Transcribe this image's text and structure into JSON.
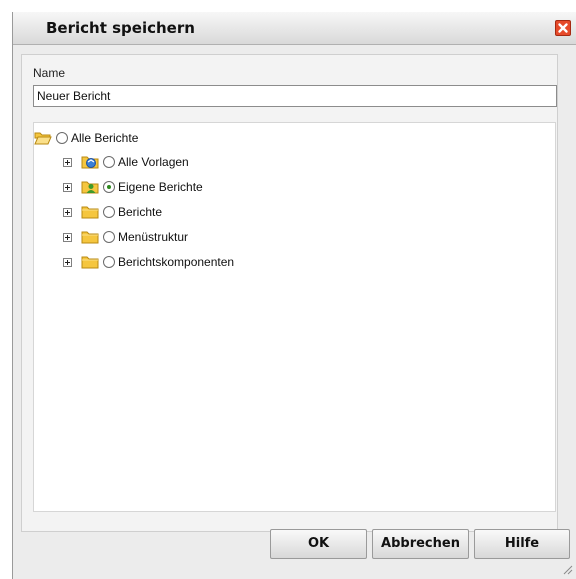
{
  "dialog": {
    "title": "Bericht speichern",
    "name_label": "Name",
    "name_value": "Neuer Bericht"
  },
  "tree": {
    "root": {
      "label": "Alle Berichte",
      "icon": "folder-open-icon",
      "selected": false
    },
    "children": [
      {
        "label": "Alle Vorlagen",
        "icon": "templates-folder-icon",
        "selected": false
      },
      {
        "label": "Eigene Berichte",
        "icon": "user-folder-icon",
        "selected": true
      },
      {
        "label": "Berichte",
        "icon": "folder-icon",
        "selected": false
      },
      {
        "label": "Menüstruktur",
        "icon": "folder-icon",
        "selected": false
      },
      {
        "label": "Berichtskomponenten",
        "icon": "folder-icon",
        "selected": false
      }
    ]
  },
  "buttons": {
    "ok": "OK",
    "cancel": "Abbrechen",
    "help": "Hilfe"
  },
  "colors": {
    "close": "#e64a2a",
    "radio_selected": "#2f8a1e",
    "folder": "#f4c94a"
  }
}
